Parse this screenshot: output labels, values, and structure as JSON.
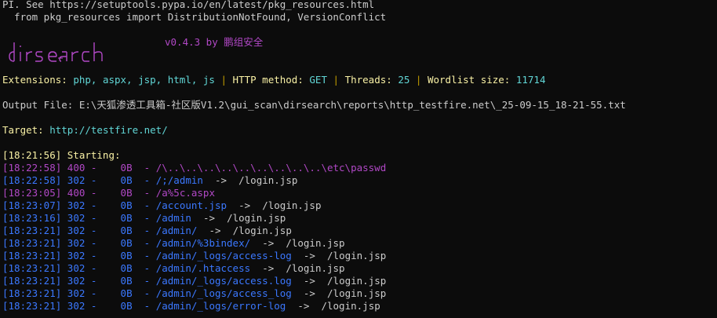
{
  "warning": {
    "line1": "PI. See https://setuptools.pypa.io/en/latest/pkg_resources.html",
    "line2": "  from pkg_resources import DistributionNotFound, VersionConflict"
  },
  "banner": {
    "logo_text": "dirsearch",
    "version": "v0.4.3 by 鹏组安全"
  },
  "config": {
    "extensions_label": "Extensions:",
    "extensions_value": "php, aspx, jsp, html, js",
    "sep": "|",
    "method_label": "HTTP method:",
    "method_value": "GET",
    "threads_label": "Threads:",
    "threads_value": "25",
    "wordlist_label": "Wordlist size:",
    "wordlist_value": "11714"
  },
  "output_file": "Output File: E:\\天狐渗透工具箱-社区版V1.2\\gui_scan\\dirsearch\\reports\\http_testfire.net\\_25-09-15_18-21-55.txt",
  "target": {
    "label": "Target:",
    "value": "http://testfire.net/"
  },
  "starting": "[18:21:56] Starting:",
  "results": [
    {
      "time": "[18:22:58]",
      "status": "400 -",
      "size": "0B",
      "path": "- /\\..\\..\\..\\..\\..\\..\\..\\..\\..\\etc\\passwd",
      "arrow": "",
      "redirect": "",
      "color": "#b148c6"
    },
    {
      "time": "[18:22:58]",
      "status": "302 -",
      "size": "0B",
      "path": "- /;/admin",
      "arrow": "->",
      "redirect": "/login.jsp",
      "color": "#3b78ff"
    },
    {
      "time": "[18:23:05]",
      "status": "400 -",
      "size": "0B",
      "path": "- /a%5c.aspx",
      "arrow": "",
      "redirect": "",
      "color": "#b148c6"
    },
    {
      "time": "[18:23:07]",
      "status": "302 -",
      "size": "0B",
      "path": "- /account.jsp",
      "arrow": "->",
      "redirect": "/login.jsp",
      "color": "#3b78ff"
    },
    {
      "time": "[18:23:16]",
      "status": "302 -",
      "size": "0B",
      "path": "- /admin",
      "arrow": "->",
      "redirect": "/login.jsp",
      "color": "#3b78ff"
    },
    {
      "time": "[18:23:21]",
      "status": "302 -",
      "size": "0B",
      "path": "- /admin/",
      "arrow": "->",
      "redirect": "/login.jsp",
      "color": "#3b78ff"
    },
    {
      "time": "[18:23:21]",
      "status": "302 -",
      "size": "0B",
      "path": "- /admin/%3bindex/",
      "arrow": "->",
      "redirect": "/login.jsp",
      "color": "#3b78ff"
    },
    {
      "time": "[18:23:21]",
      "status": "302 -",
      "size": "0B",
      "path": "- /admin/_logs/access-log",
      "arrow": "->",
      "redirect": "/login.jsp",
      "color": "#3b78ff"
    },
    {
      "time": "[18:23:21]",
      "status": "302 -",
      "size": "0B",
      "path": "- /admin/.htaccess",
      "arrow": "->",
      "redirect": "/login.jsp",
      "color": "#3b78ff"
    },
    {
      "time": "[18:23:21]",
      "status": "302 -",
      "size": "0B",
      "path": "- /admin/_logs/access.log",
      "arrow": "->",
      "redirect": "/login.jsp",
      "color": "#3b78ff"
    },
    {
      "time": "[18:23:21]",
      "status": "302 -",
      "size": "0B",
      "path": "- /admin/_logs/access_log",
      "arrow": "->",
      "redirect": "/login.jsp",
      "color": "#3b78ff"
    },
    {
      "time": "[18:23:21]",
      "status": "302 -",
      "size": "0B",
      "path": "- /admin/_logs/error-log",
      "arrow": "->",
      "redirect": "/login.jsp",
      "color": "#3b78ff"
    }
  ],
  "colors": {
    "background": "#0c0c0c",
    "text": "#cccccc",
    "highlight": "#f9f1a5",
    "value": "#61d6d6",
    "status_302": "#3b78ff",
    "status_400": "#b148c6"
  }
}
